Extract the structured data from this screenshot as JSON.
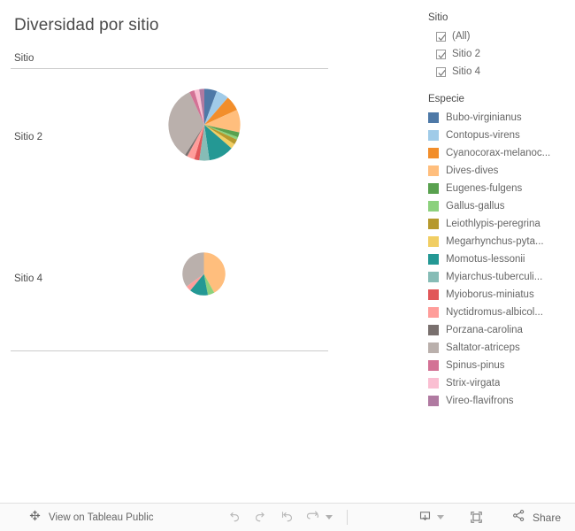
{
  "title": "Diversidad por sitio",
  "viz": {
    "column_header": "Sitio",
    "rows": [
      {
        "label": "Sitio 2"
      },
      {
        "label": "Sitio 4"
      }
    ]
  },
  "filter": {
    "title": "Sitio",
    "items": [
      {
        "label": "(All)",
        "checked": true
      },
      {
        "label": "Sitio 2",
        "checked": true
      },
      {
        "label": "Sitio 4",
        "checked": true
      }
    ]
  },
  "legend": {
    "title": "Especie",
    "items": [
      {
        "label": "Bubo-virginianus",
        "color": "#4e79a7"
      },
      {
        "label": "Contopus-virens",
        "color": "#a0cbe8"
      },
      {
        "label": "Cyanocorax-melanoc...",
        "color": "#f28e2b"
      },
      {
        "label": "Dives-dives",
        "color": "#ffbe7d"
      },
      {
        "label": "Eugenes-fulgens",
        "color": "#59a14f"
      },
      {
        "label": "Gallus-gallus",
        "color": "#8cd17d"
      },
      {
        "label": "Leiothlypis-peregrina",
        "color": "#b6992d"
      },
      {
        "label": "Megarhynchus-pyta...",
        "color": "#f1ce63"
      },
      {
        "label": "Momotus-lessonii",
        "color": "#249894"
      },
      {
        "label": "Myiarchus-tuberculi...",
        "color": "#86bcb6"
      },
      {
        "label": "Myioborus-miniatus",
        "color": "#e15759"
      },
      {
        "label": "Nyctidromus-albicol...",
        "color": "#ff9d9a"
      },
      {
        "label": "Porzana-carolina",
        "color": "#79706e"
      },
      {
        "label": "Saltator-atriceps",
        "color": "#bab0ac"
      },
      {
        "label": "Spinus-pinus",
        "color": "#d37295"
      },
      {
        "label": "Strix-virgata",
        "color": "#fabfd2"
      },
      {
        "label": "Vireo-flavifrons",
        "color": "#b07aa1"
      }
    ]
  },
  "chart_data": {
    "type": "pie",
    "title": "Diversidad por sitio",
    "legend_position": "right",
    "category_field": "Especie",
    "panel_field": "Sitio",
    "panels": [
      {
        "name": "Sitio 2",
        "slices": [
          {
            "label": "Bubo-virginianus",
            "value": 5,
            "color": "#4e79a7"
          },
          {
            "label": "Contopus-virens",
            "value": 5,
            "color": "#a0cbe8"
          },
          {
            "label": "Cyanocorax-melanoc...",
            "value": 6,
            "color": "#f28e2b"
          },
          {
            "label": "Dives-dives",
            "value": 9,
            "color": "#ffbe7d"
          },
          {
            "label": "Eugenes-fulgens",
            "value": 2,
            "color": "#59a14f"
          },
          {
            "label": "Gallus-gallus",
            "value": 1,
            "color": "#8cd17d"
          },
          {
            "label": "Leiothlypis-peregrina",
            "value": 2,
            "color": "#b6992d"
          },
          {
            "label": "Megarhynchus-pyta...",
            "value": 2,
            "color": "#f1ce63"
          },
          {
            "label": "Momotus-lessonii",
            "value": 10,
            "color": "#249894"
          },
          {
            "label": "Myiarchus-tuberculi...",
            "value": 4,
            "color": "#86bcb6"
          },
          {
            "label": "Myioborus-miniatus",
            "value": 2,
            "color": "#e15759"
          },
          {
            "label": "Nyctidromus-albicol...",
            "value": 3,
            "color": "#ff9d9a"
          },
          {
            "label": "Porzana-carolina",
            "value": 1,
            "color": "#79706e"
          },
          {
            "label": "Saltator-atriceps",
            "value": 30,
            "color": "#bab0ac"
          },
          {
            "label": "Spinus-pinus",
            "value": 2,
            "color": "#d37295"
          },
          {
            "label": "Strix-virgata",
            "value": 2,
            "color": "#fabfd2"
          },
          {
            "label": "Vireo-flavifrons",
            "value": 2,
            "color": "#b07aa1"
          }
        ]
      },
      {
        "name": "Sitio 4",
        "slices": [
          {
            "label": "Dives-dives",
            "value": 42,
            "color": "#ffbe7d"
          },
          {
            "label": "Gallus-gallus",
            "value": 5,
            "color": "#8cd17d"
          },
          {
            "label": "Momotus-lessonii",
            "value": 14,
            "color": "#249894"
          },
          {
            "label": "Nyctidromus-albicol...",
            "value": 4,
            "color": "#ff9d9a"
          },
          {
            "label": "Saltator-atriceps",
            "value": 35,
            "color": "#bab0ac"
          }
        ]
      }
    ]
  },
  "footer": {
    "tableau_link": "View on Tableau Public",
    "share_label": "Share",
    "icons": {
      "undo": "undo-icon",
      "redo": "redo-icon",
      "revert": "revert-icon",
      "refresh": "refresh-icon",
      "download": "download-icon",
      "fullscreen": "fullscreen-icon",
      "share": "share-icon"
    }
  }
}
